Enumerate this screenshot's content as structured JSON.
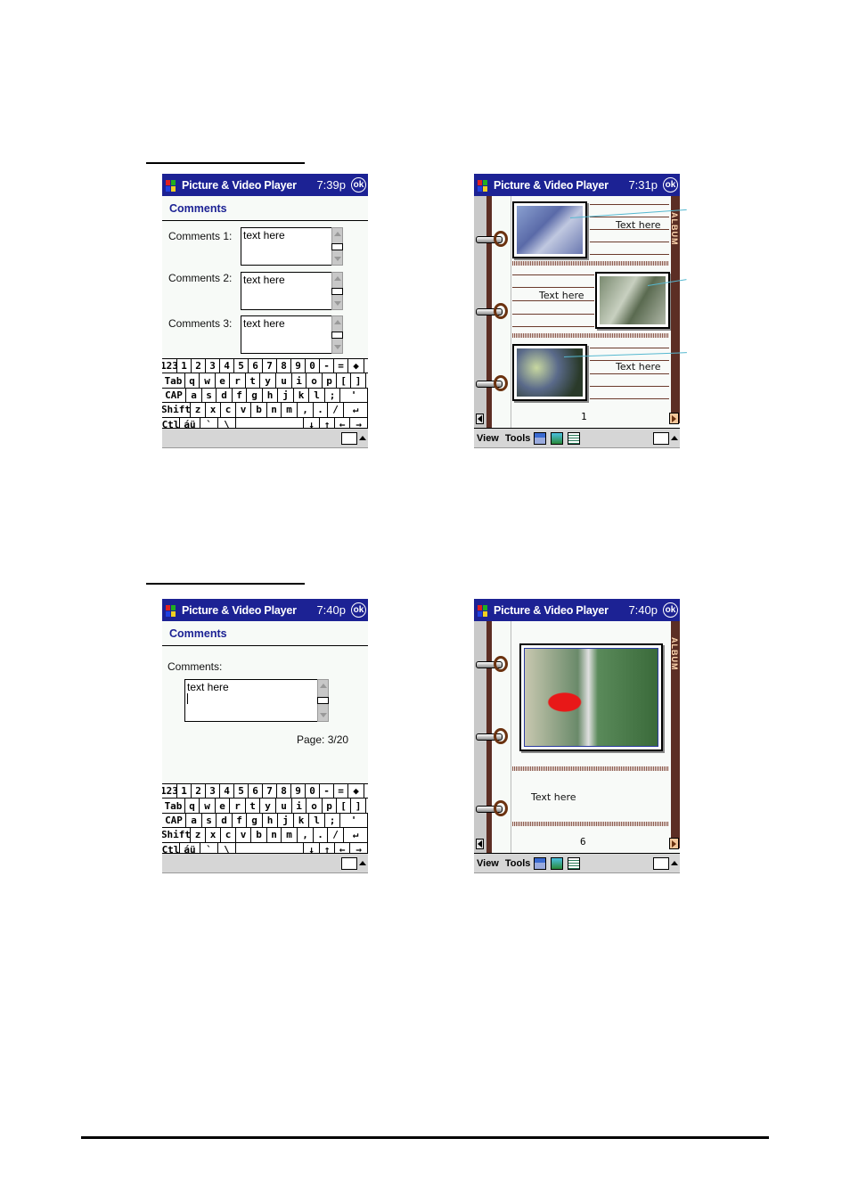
{
  "app_title": "Picture & Video Player",
  "ok_label": "ok",
  "screens": [
    {
      "id": "comments-multi",
      "time": "7:39p",
      "heading": "Comments",
      "fields": [
        {
          "label": "Comments 1:",
          "value": "text here"
        },
        {
          "label": "Comments 2:",
          "value": "text here"
        },
        {
          "label": "Comments 3:",
          "value": "text here"
        }
      ]
    },
    {
      "id": "album-page-1",
      "time": "7:31p",
      "album_tab": "ALBUM",
      "captions": [
        "Text here",
        "Text here",
        "Text here"
      ],
      "page_number": "1"
    },
    {
      "id": "comments-single",
      "time": "7:40p",
      "heading": "Comments",
      "field_label": "Comments:",
      "field_value": "text here",
      "page_indicator": "Page: 3/20"
    },
    {
      "id": "album-page-6",
      "time": "7:40p",
      "album_tab": "ALBUM",
      "caption": "Text here",
      "page_number": "6"
    }
  ],
  "keyboard": {
    "rows": [
      [
        "123",
        "1",
        "2",
        "3",
        "4",
        "5",
        "6",
        "7",
        "8",
        "9",
        "0",
        "-",
        "=",
        "◆"
      ],
      [
        "Tab",
        "q",
        "w",
        "e",
        "r",
        "t",
        "y",
        "u",
        "i",
        "o",
        "p",
        "[",
        "]"
      ],
      [
        "CAP",
        "a",
        "s",
        "d",
        "f",
        "g",
        "h",
        "j",
        "k",
        "l",
        ";",
        "'"
      ],
      [
        "Shift",
        "z",
        "x",
        "c",
        "v",
        "b",
        "n",
        "m",
        ",",
        ".",
        "/",
        "↵"
      ],
      [
        "Ctl",
        "áü",
        "`",
        "\\",
        " ",
        "↓",
        "↑",
        "←",
        "→"
      ]
    ]
  },
  "menubar": {
    "view_label": "View",
    "tools_label": "Tools",
    "icons": [
      "save-icon",
      "picture-icon",
      "list-icon"
    ]
  },
  "colors": {
    "titlebar": "#1c2294",
    "album_spine": "#5c2e24",
    "album_tab_text": "#ffd7b0",
    "callout_line": "#55b8d0"
  }
}
